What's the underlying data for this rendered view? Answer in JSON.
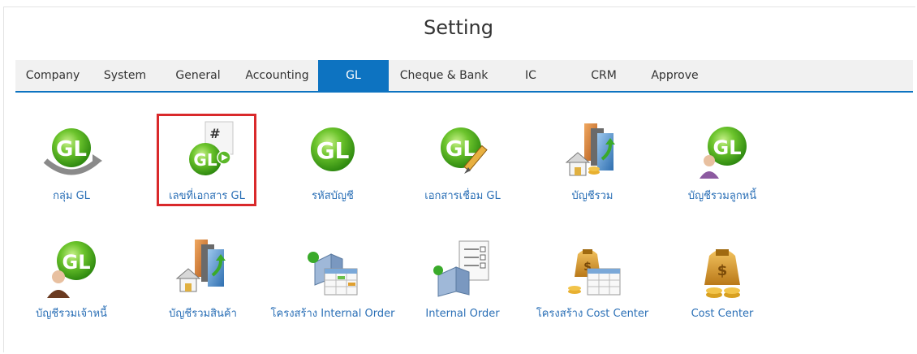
{
  "page": {
    "title": "Setting"
  },
  "tabs": [
    {
      "label": "Company",
      "active": false
    },
    {
      "label": "System",
      "active": false
    },
    {
      "label": "General",
      "active": false
    },
    {
      "label": "Accounting",
      "active": false
    },
    {
      "label": "GL",
      "active": true
    },
    {
      "label": "Cheque & Bank",
      "active": false
    },
    {
      "label": "IC",
      "active": false
    },
    {
      "label": "CRM",
      "active": false
    },
    {
      "label": "Approve",
      "active": false
    }
  ],
  "items": [
    {
      "label": "กลุ่ม GL",
      "icon": "gl-group-icon"
    },
    {
      "label": "เลขที่เอกสาร GL",
      "icon": "gl-doc-number-icon",
      "highlighted": true
    },
    {
      "label": "รหัสบัญชี",
      "icon": "gl-account-code-icon"
    },
    {
      "label": "เอกสารเชื่อม GL",
      "icon": "gl-doc-link-icon"
    },
    {
      "label": "บัญชีรวม",
      "icon": "summary-account-icon"
    },
    {
      "label": "บัญชีรวมลูกหนี้",
      "icon": "gl-debtor-icon"
    },
    {
      "label": "บัญชีรวมเจ้าหนี้",
      "icon": "gl-creditor-icon"
    },
    {
      "label": "บัญชีรวมสินค้า",
      "icon": "inventory-account-icon"
    },
    {
      "label": "โครงสร้าง Internal Order",
      "icon": "internal-order-structure-icon"
    },
    {
      "label": "Internal Order",
      "icon": "internal-order-icon"
    },
    {
      "label": "โครงสร้าง Cost Center",
      "icon": "cost-center-structure-icon"
    },
    {
      "label": "Cost Center",
      "icon": "cost-center-icon"
    }
  ],
  "colors": {
    "accent": "#0d73c1",
    "link": "#2a6fb6",
    "highlight": "#d9292b",
    "gl_green": "#55b81f"
  }
}
